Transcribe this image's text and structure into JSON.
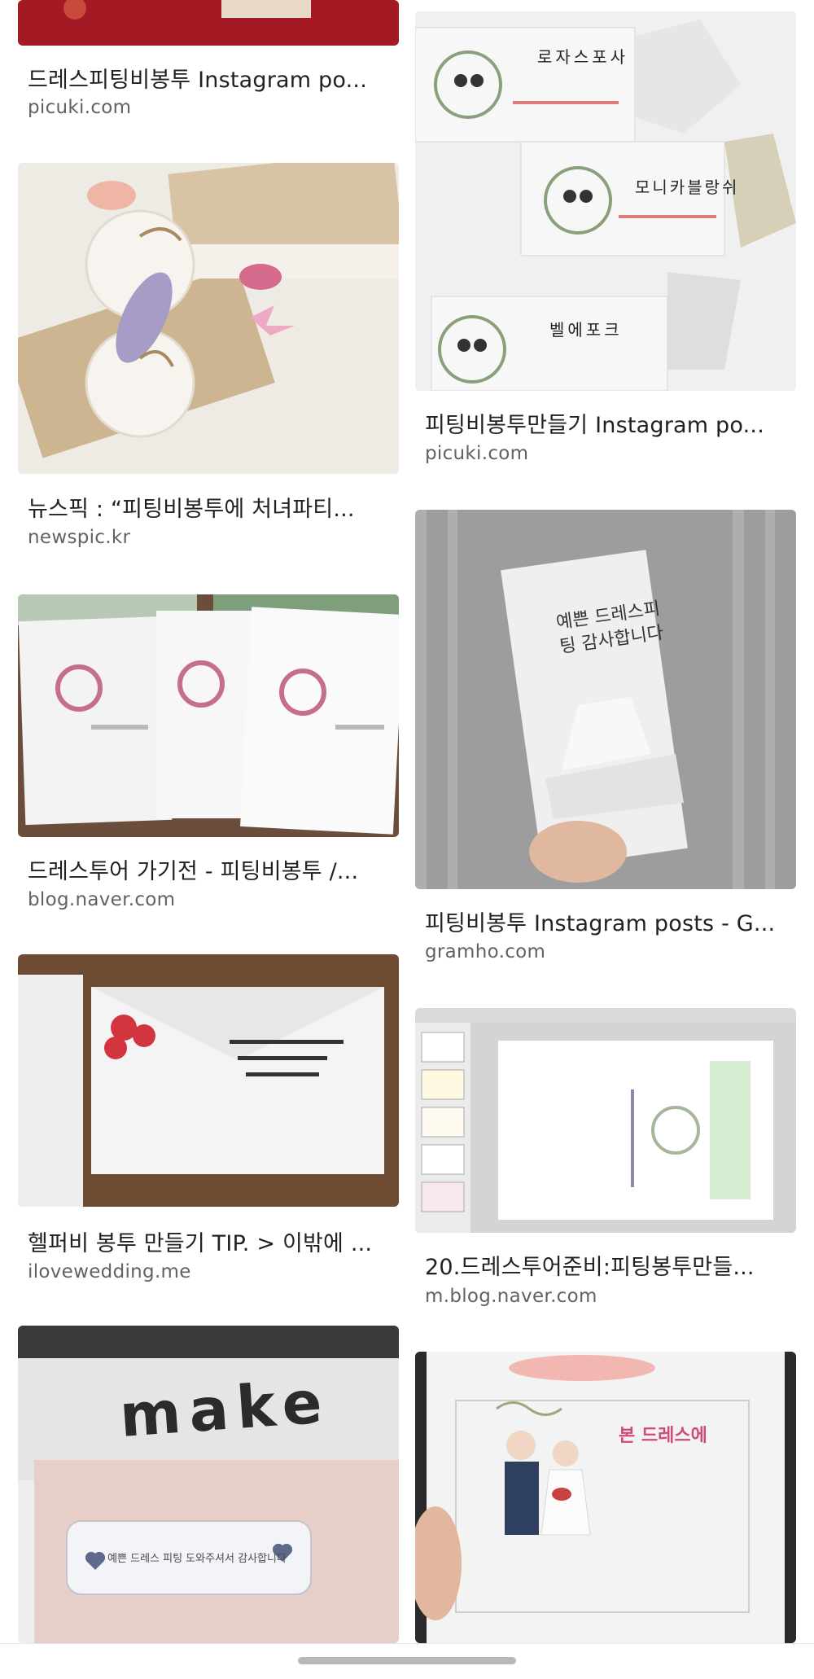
{
  "results": {
    "left": [
      {
        "title": "드레스피팅비봉투 Instagram po...",
        "source": "picuki.com"
      },
      {
        "title": "뉴스픽 : “피팅비봉투에 처녀파티...",
        "source": "newspic.kr"
      },
      {
        "title": "드레스투어 가기전 - 피팅비봉투 /...",
        "source": "blog.naver.com"
      },
      {
        "title": "헬퍼비 봉투 만들기 TIP. > 이밖에 ...",
        "source": "ilovewedding.me"
      },
      {
        "title": "",
        "source": ""
      }
    ],
    "right": [
      {
        "title": "피팅비봉투만들기 Instagram po...",
        "source": "picuki.com"
      },
      {
        "title": "피팅비봉투 Instagram posts - G...",
        "source": "gramho.com"
      },
      {
        "title": "20.드레스투어준비:피팅봉투만들...",
        "source": "m.blog.naver.com"
      },
      {
        "title": "",
        "source": ""
      }
    ]
  },
  "thumb_text": {
    "envelope_labels": [
      "로자스포사",
      "모니카블랑쉬",
      "벨에포크"
    ],
    "dress_card_text": "예쁜 드레스피팅 감사합니다",
    "sign_text": "make",
    "tag_text": "예쁜 드레스 피팅 도와주셔서 감사합니다",
    "pink_title": "본 드레스에"
  }
}
